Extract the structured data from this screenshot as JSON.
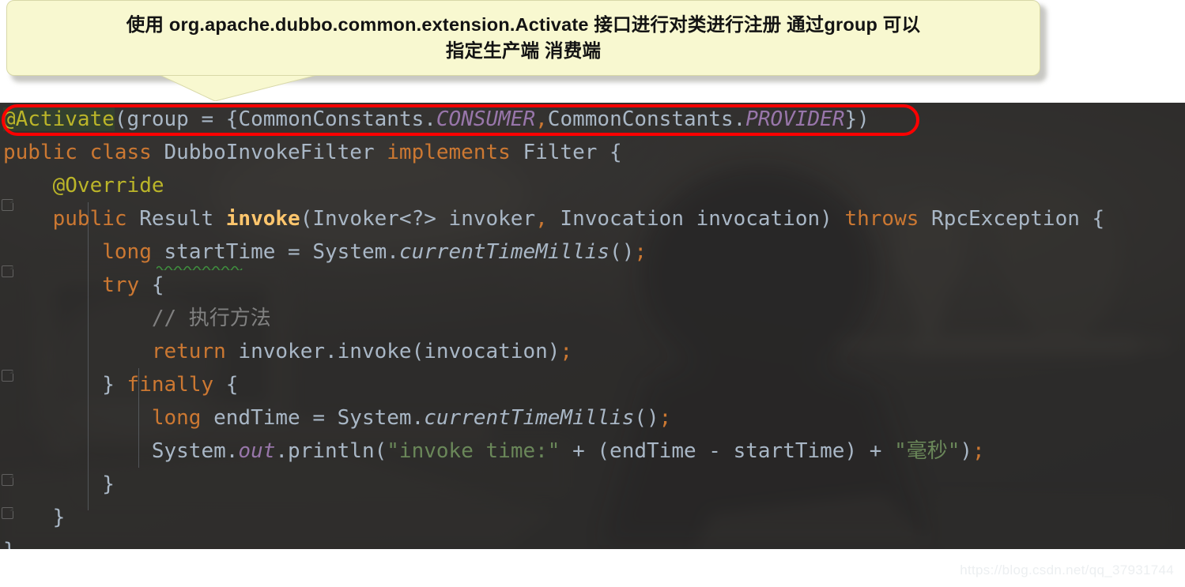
{
  "callout": {
    "line1": "使用 org.apache.dubbo.common.extension.Activate 接口进行对类进行注册 通过group 可以",
    "line2": "指定生产端 消费端",
    "bg_color": "#f8f8d0",
    "text_color": "#131313"
  },
  "editor": {
    "background_color": "#2b2b2b",
    "default_text_color": "#a9b7c6",
    "highlight_ring_color": "#ff0000",
    "lines": [
      {
        "id": "line-activate-annotation",
        "indent": 0,
        "tokens": [
          {
            "t": "@Activate",
            "c": "annhl"
          },
          {
            "t": "(",
            "c": "txt"
          },
          {
            "t": "group",
            "c": "txt"
          },
          {
            "t": " = {",
            "c": "txt"
          },
          {
            "t": "CommonConstants.",
            "c": "txt"
          },
          {
            "t": "CONSUMER",
            "c": "stat"
          },
          {
            "t": ",",
            "c": "semi"
          },
          {
            "t": "CommonConstants.",
            "c": "txt"
          },
          {
            "t": "PROVIDER",
            "c": "stat"
          },
          {
            "t": "})",
            "c": "txt"
          }
        ]
      },
      {
        "id": "line-class-declaration",
        "indent": 0,
        "tokens": [
          {
            "t": "public class ",
            "c": "kw"
          },
          {
            "t": "DubboInvokeFilter ",
            "c": "txt"
          },
          {
            "t": "implements ",
            "c": "kw"
          },
          {
            "t": "Filter {",
            "c": "txt"
          }
        ]
      },
      {
        "id": "line-override-annotation",
        "indent": 1,
        "tokens": [
          {
            "t": "@Override",
            "c": "ann"
          }
        ]
      },
      {
        "id": "line-invoke-signature",
        "indent": 1,
        "tokens": [
          {
            "t": "public ",
            "c": "kw"
          },
          {
            "t": "Result ",
            "c": "txt"
          },
          {
            "t": "invoke",
            "c": "mth"
          },
          {
            "t": "(Invoker<?> invoker",
            "c": "txt"
          },
          {
            "t": ",",
            "c": "semi"
          },
          {
            "t": " Invocation invocation) ",
            "c": "txt"
          },
          {
            "t": "throws ",
            "c": "kw"
          },
          {
            "t": "RpcException {",
            "c": "txt"
          }
        ]
      },
      {
        "id": "line-start-time",
        "indent": 2,
        "tokens": [
          {
            "t": "long ",
            "c": "kw"
          },
          {
            "t": "startTime = System.",
            "c": "txt"
          },
          {
            "t": "currentTimeMillis",
            "c": "statm"
          },
          {
            "t": "()",
            "c": "txt"
          },
          {
            "t": ";",
            "c": "semi"
          }
        ]
      },
      {
        "id": "line-try",
        "indent": 2,
        "tokens": [
          {
            "t": "try ",
            "c": "kw"
          },
          {
            "t": "{",
            "c": "txt"
          }
        ]
      },
      {
        "id": "line-comment-execute",
        "indent": 3,
        "tokens": [
          {
            "t": "// 执行方法",
            "c": "cmt"
          }
        ]
      },
      {
        "id": "line-return-invoke",
        "indent": 3,
        "tokens": [
          {
            "t": "return ",
            "c": "kw"
          },
          {
            "t": "invoker.invoke(invocation)",
            "c": "txt"
          },
          {
            "t": ";",
            "c": "semi"
          }
        ]
      },
      {
        "id": "line-finally",
        "indent": 2,
        "tokens": [
          {
            "t": "} ",
            "c": "txt"
          },
          {
            "t": "finally ",
            "c": "kw"
          },
          {
            "t": "{",
            "c": "txt"
          }
        ]
      },
      {
        "id": "line-end-time",
        "indent": 3,
        "tokens": [
          {
            "t": "long ",
            "c": "kw"
          },
          {
            "t": "endTime = System.",
            "c": "txt"
          },
          {
            "t": "currentTimeMillis",
            "c": "statm"
          },
          {
            "t": "()",
            "c": "txt"
          },
          {
            "t": ";",
            "c": "semi"
          }
        ]
      },
      {
        "id": "line-println",
        "indent": 3,
        "tokens": [
          {
            "t": "System.",
            "c": "txt"
          },
          {
            "t": "out",
            "c": "stat"
          },
          {
            "t": ".println(",
            "c": "txt"
          },
          {
            "t": "\"invoke time:\"",
            "c": "str"
          },
          {
            "t": " + (endTime - startTime) + ",
            "c": "txt"
          },
          {
            "t": "\"毫秒\"",
            "c": "str"
          },
          {
            "t": ")",
            "c": "txt"
          },
          {
            "t": ";",
            "c": "semi"
          }
        ]
      },
      {
        "id": "line-close-finally",
        "indent": 2,
        "tokens": [
          {
            "t": "}",
            "c": "txt"
          }
        ]
      },
      {
        "id": "line-close-method",
        "indent": 1,
        "tokens": [
          {
            "t": "}",
            "c": "txt"
          }
        ]
      },
      {
        "id": "line-close-class",
        "indent": 0,
        "tokens": [
          {
            "t": "}",
            "c": "txt"
          }
        ]
      }
    ]
  },
  "watermark": {
    "text": "https://blog.csdn.net/qq_37931744"
  }
}
